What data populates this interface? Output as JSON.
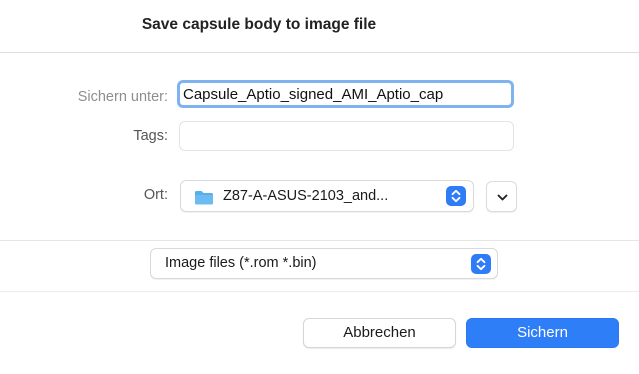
{
  "dialog": {
    "title": "Save capsule body to image file"
  },
  "save_as": {
    "label": "Sichern unter:",
    "value": "Capsule_Aptio_signed_AMI_Aptio_cap"
  },
  "tags": {
    "label": "Tags:",
    "value": ""
  },
  "location": {
    "label": "Ort:",
    "value": "Z87-A-ASUS-2103_and...",
    "icon": "folder-icon",
    "folder_color": "#5aaeea"
  },
  "format": {
    "value": "Image files (*.rom *.bin)"
  },
  "buttons": {
    "cancel_label": "Abbrechen",
    "save_label": "Sichern"
  },
  "colors": {
    "accent": "#2e7ef7",
    "focus_ring": "#7fb2f0"
  }
}
